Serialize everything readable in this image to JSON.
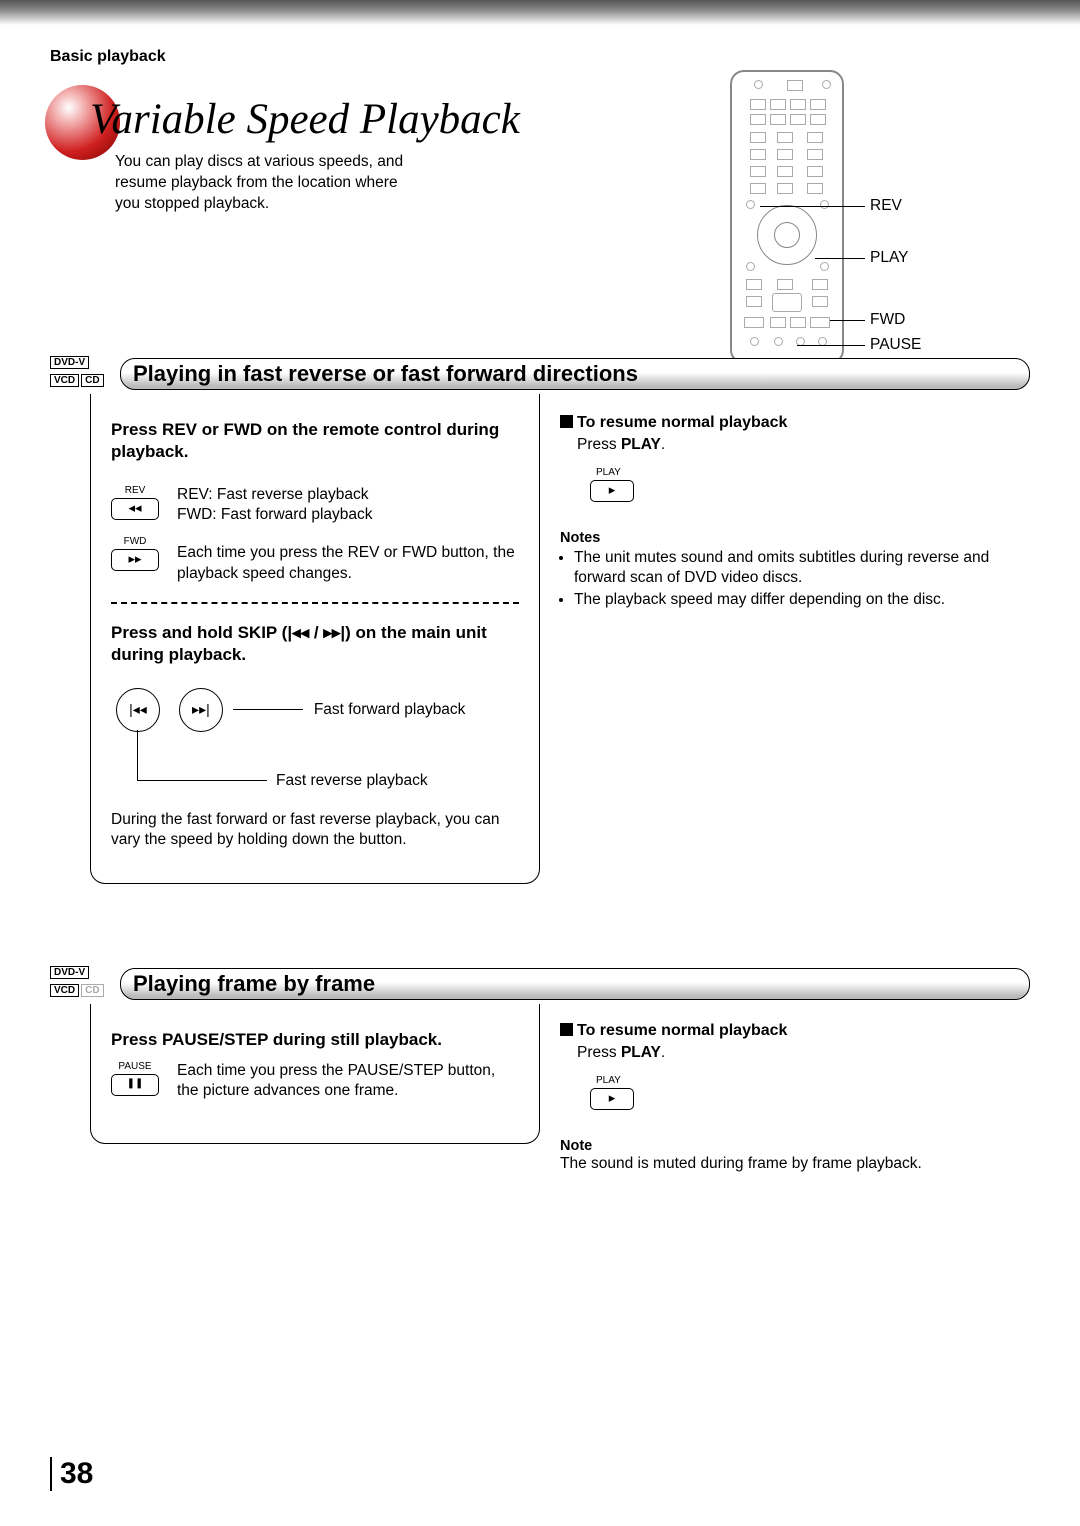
{
  "header": {
    "section": "Basic playback"
  },
  "title": "Variable Speed Playback",
  "intro": "You can play discs at various speeds, and\nresume playback from the location where\nyou stopped playback.",
  "remote_labels": {
    "rev": "REV",
    "play": "PLAY",
    "fwd": "FWD",
    "pause": "PAUSE"
  },
  "section1": {
    "badges": [
      "DVD-V",
      "VCD",
      "CD"
    ],
    "title": "Playing in fast reverse or fast forward directions",
    "left": {
      "head1": "Press REV or FWD on the remote control during playback.",
      "rev_lbl": "REV",
      "rev_icon": "◂◂",
      "fwd_lbl": "FWD",
      "fwd_icon": "▸▸",
      "desc1a": "REV:  Fast reverse playback",
      "desc1b": "FWD: Fast forward playback",
      "desc2": "Each time you press the REV or FWD button, the playback speed changes.",
      "head2": "Press and hold SKIP (|◂◂ / ▸▸|) on the main unit during playback.",
      "skip_prev": "|◂◂",
      "skip_next": "▸▸|",
      "ff_label": "Fast forward playback",
      "fr_label": "Fast reverse playback",
      "note": "During the fast forward or fast reverse playback, you can vary the speed by holding down the button."
    },
    "right": {
      "resume_hd": "To resume normal playback",
      "resume_body_a": "Press ",
      "resume_body_b": "PLAY",
      "resume_body_c": ".",
      "play_lbl": "PLAY",
      "play_icon": "▸",
      "notes_hd": "Notes",
      "notes": [
        "The unit mutes sound and omits subtitles during reverse and forward scan of DVD video discs.",
        "The playback speed may differ depending on the disc."
      ]
    }
  },
  "section2": {
    "badges": [
      "DVD-V",
      "VCD"
    ],
    "badge_dim": "CD",
    "title": "Playing frame by frame",
    "left": {
      "head": "Press PAUSE/STEP during still playback.",
      "pause_lbl": "PAUSE",
      "pause_icon": "❚❚",
      "desc": "Each time you press the PAUSE/STEP button, the picture advances one frame."
    },
    "right": {
      "resume_hd": "To resume normal playback",
      "resume_body_a": "Press ",
      "resume_body_b": "PLAY",
      "resume_body_c": ".",
      "play_lbl": "PLAY",
      "play_icon": "▸",
      "note_hd": "Note",
      "note": "The sound is muted during frame by frame playback."
    }
  },
  "page_number": "38"
}
